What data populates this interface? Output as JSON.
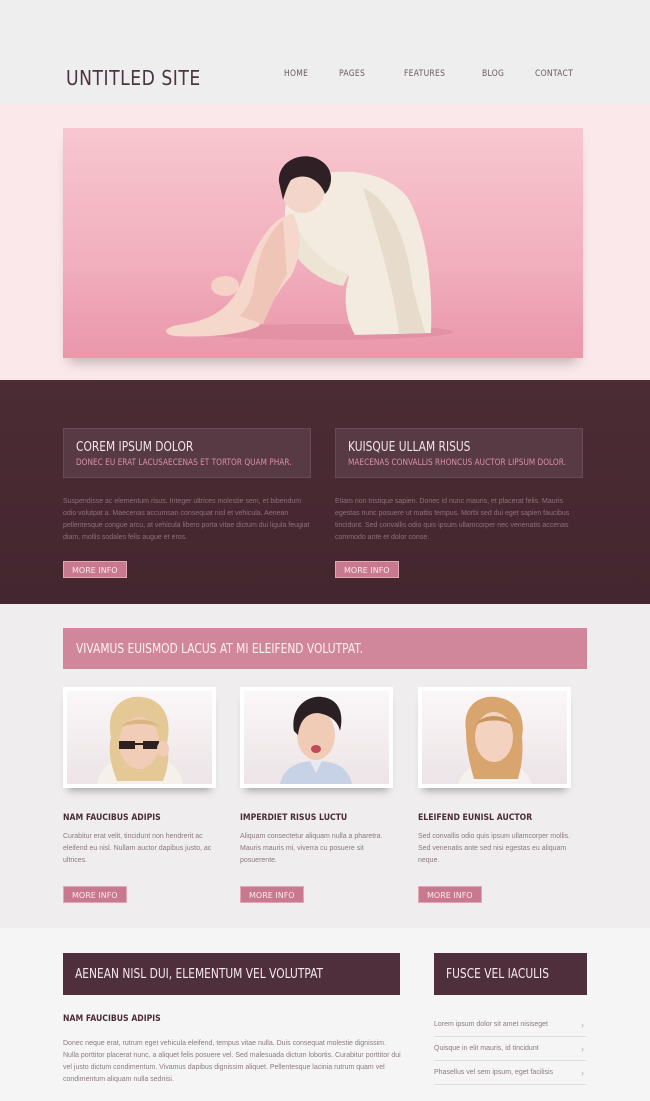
{
  "header": {
    "site_title": "UNTITLED SITE",
    "nav": [
      "HOME",
      "PAGES",
      "FEATURES",
      "BLOG",
      "CONTACT"
    ]
  },
  "features": [
    {
      "title": "COREM IPSUM DOLOR",
      "subtitle": "DONEC EU ERAT LACUSAECENAS ET TORTOR QUAM PHAR.",
      "text": "Suspendisse ac elementum risus. Integer ultrices molestie sem, et bibendum odio volutpat a. Maecenas accumsan consequat nisl et vehicula. Aenean pellentesque congue arcu, at vehicula libero porta vitae dictum dui ligula feugiat diam, mollis sodales felis augue et eros.",
      "button": "MORE INFO"
    },
    {
      "title": "KUISQUE ULLAM RISUS",
      "subtitle": "MAECENAS CONVALLIS RHONCUS AUCTOR LIPSUM DOLOR.",
      "text": "Etiam non tristique sapien. Donec id nunc mauris, et placerat felis. Mauris egestas nunc posuere ut mattis tempus. Morbi sed dui eget sapien faucibus tincidunt. Sed convallis odio quis ipsum ullamcorper nec venenatis accenas commodo ante et dolor conse.",
      "button": "MORE INFO"
    }
  ],
  "team": {
    "banner": "VIVAMUS EUISMOD LACUS AT MI ELEIFEND VOLUTPAT.",
    "people": [
      {
        "name": "NAM FAUCIBUS ADIPIS",
        "text": "Curabitur erat velit, tincidunt non hendrerit ac eleifend eu nisl. Nullam auctor dapibus justo, ac ultrices.",
        "button": "MORE INFO"
      },
      {
        "name": "IMPERDIET RISUS LUCTU",
        "text": "Aliquam consectetur aliquam nulla a pharetra. Mauris mauris mi, viverra cu posuere sit posuerente.",
        "button": "MORE INFO"
      },
      {
        "name": "ELEIFEND EUNISL AUCTOR",
        "text": "Sed convallis odio quis ipsum ullamcorper mollis. Sed venenatis ante sed nisi egestas eu aliquam neque.",
        "button": "MORE INFO"
      }
    ]
  },
  "bottom": {
    "main_heading": "AENEAN NISL DUI, ELEMENTUM VEL VOLUTPAT",
    "article_title": "NAM FAUCIBUS ADIPIS",
    "article_text": "Donec neque erat, rutrum eget vehicula eleifend, tempus vitae nulla. Duis consequat molestie dignissim. Nulla porttitor placerat nunc, a aliquet felis posuere vel. Sed malesuada dictum lobortis. Curabitur porttitor dui vel justo dictum condimentum. Vivamus dapibus dignissim aliquet. Pellentesque lacinia rutrum quam vel condimentum aliquam nulla sednisi.",
    "side_heading": "FUSCE VEL IACULIS",
    "side_links": [
      "Lorem ipsum dolor sit amet nisiseget",
      "Quisque in elit mauris, id tincidunt",
      "Phasellus vel sem ipsum, eget facilisis"
    ]
  },
  "colors": {
    "brand_dark": "#4b2c34",
    "accent_pink": "#d1879b",
    "button_pink": "#c9798f",
    "hero_pink": "#f2b0bf"
  },
  "icons": {
    "list_chevron": "chevron-right-icon"
  }
}
